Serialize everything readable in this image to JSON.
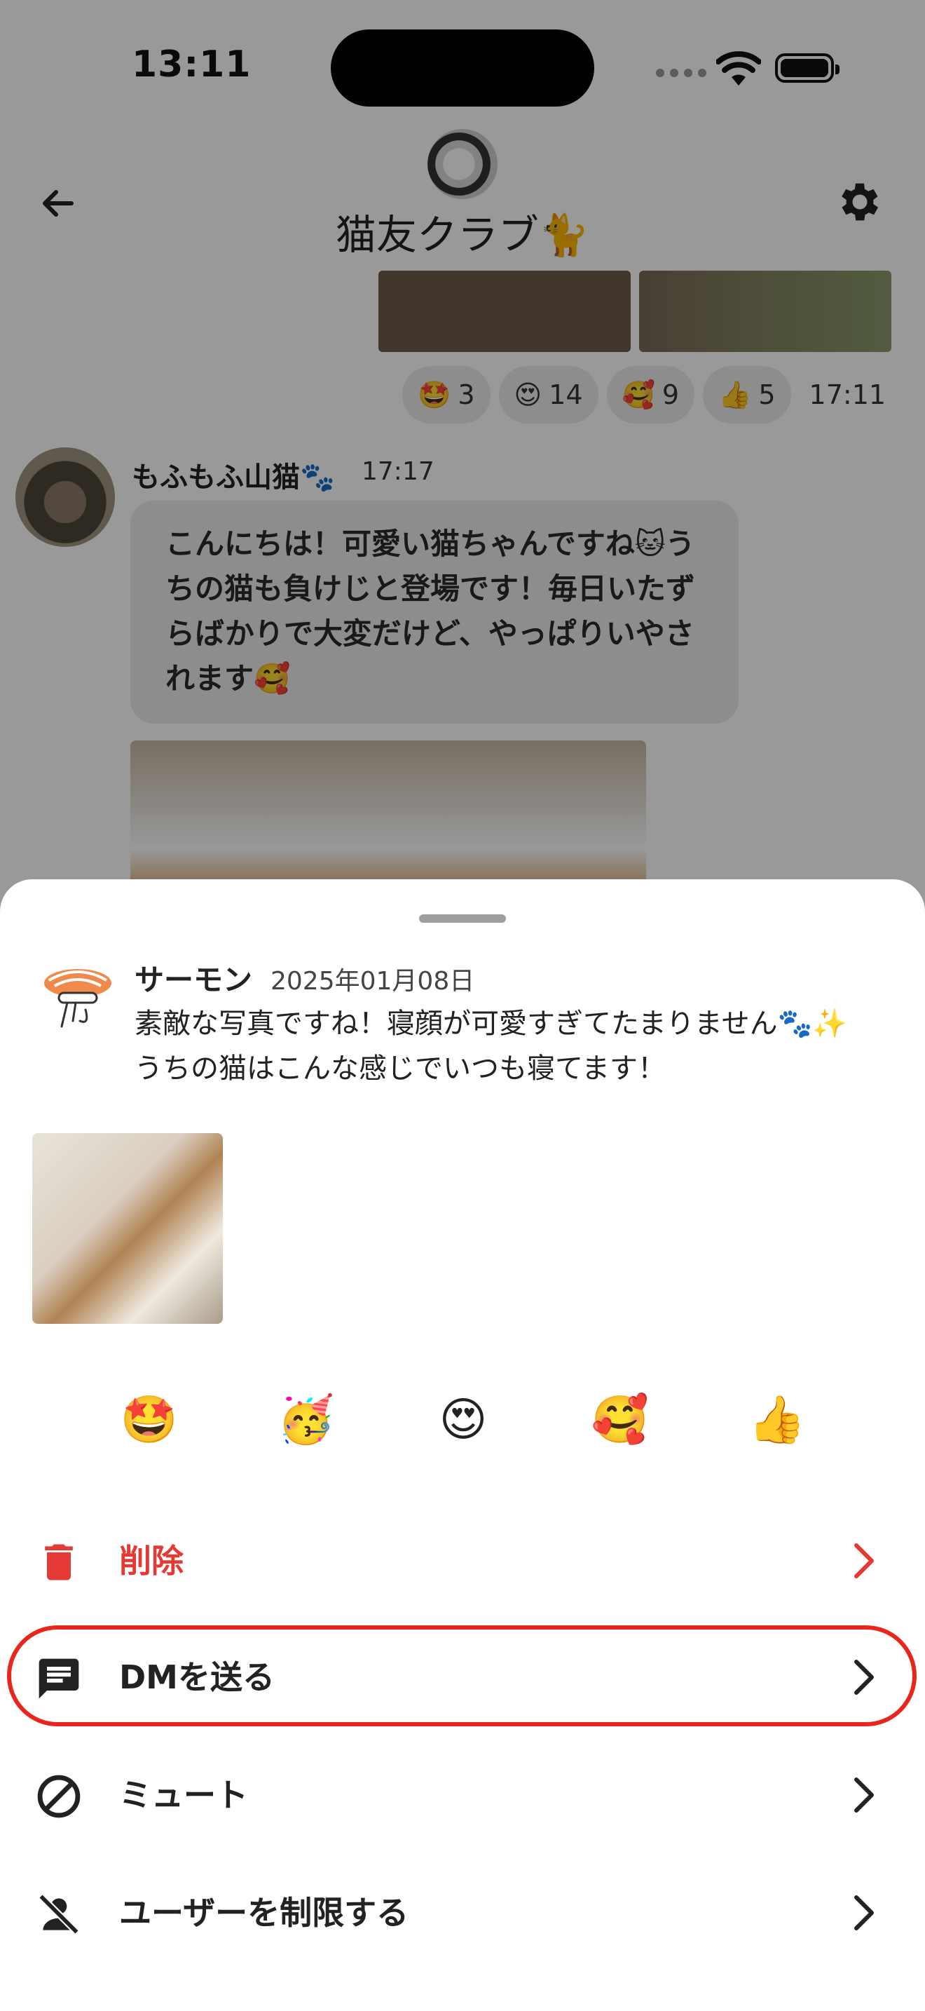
{
  "status": {
    "time": "13:11"
  },
  "chat": {
    "title": "猫友クラブ🐈",
    "reactions": [
      {
        "emoji": "🤩",
        "count": "3"
      },
      {
        "emoji": "😍",
        "count": "14"
      },
      {
        "emoji": "🥰",
        "count": "9"
      },
      {
        "emoji": "👍",
        "count": "5"
      }
    ],
    "reactions_time": "17:11",
    "message": {
      "author": "もふもふ山猫🐾",
      "time": "17:17",
      "text": "こんにちは！可愛い猫ちゃんですね🐱うちの猫も負けじと登場です！毎日いたずらばかりで大変だけど、やっぱりいやされます🥰"
    }
  },
  "sheet": {
    "author": "サーモン",
    "date": "2025年01月08日",
    "text": "素敵な写真ですね！寝顔が可愛すぎてたまりません🐾✨ うちの猫はこんな感じでいつも寝てます！",
    "quick_reactions": [
      "🤩",
      "🥳",
      "😍",
      "🥰",
      "👍"
    ],
    "menu": {
      "delete": "削除",
      "dm": "DMを送る",
      "mute": "ミュート",
      "restrict": "ユーザーを制限する"
    },
    "colors": {
      "danger": "#e53935",
      "highlight": "#e8261c"
    }
  }
}
